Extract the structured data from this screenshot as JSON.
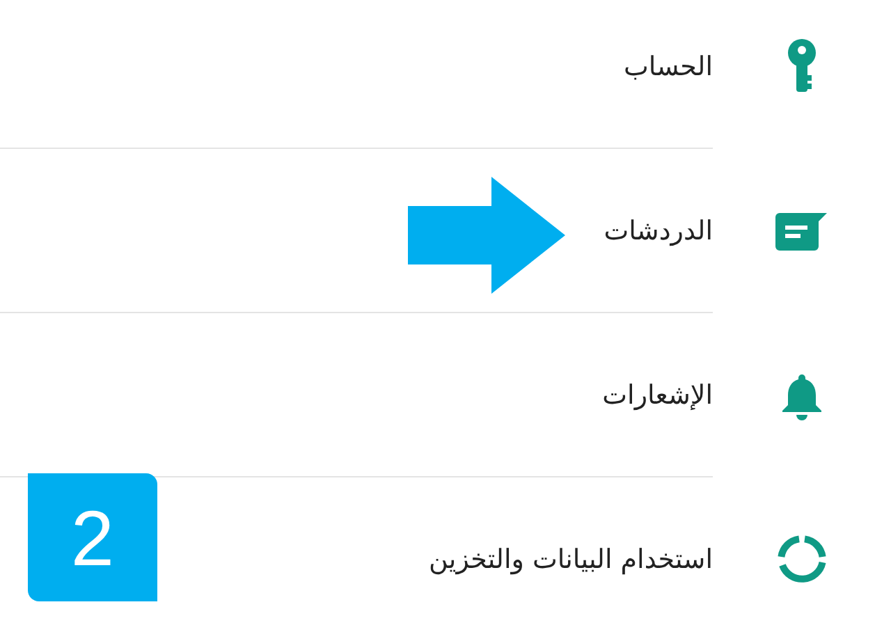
{
  "settings": [
    {
      "title": "الحساب",
      "kind": "key"
    },
    {
      "title": "الدردشات",
      "kind": "chat"
    },
    {
      "title": "الإشعارات",
      "kind": "bell"
    },
    {
      "title": "استخدام البيانات والتخزين",
      "kind": "data"
    }
  ],
  "step_badge": "2"
}
